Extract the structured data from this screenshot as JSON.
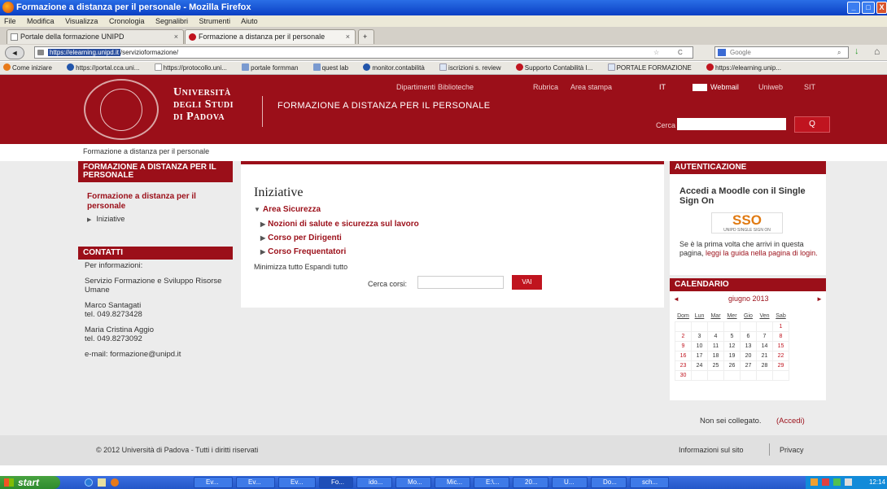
{
  "window": {
    "title": "Formazione a distanza per il personale - Mozilla Firefox",
    "min": "_",
    "max": "□",
    "close": "X"
  },
  "menu": [
    "File",
    "Modifica",
    "Visualizza",
    "Cronologia",
    "Segnalibri",
    "Strumenti",
    "Aiuto"
  ],
  "tabs": [
    {
      "label": "Portale della formazione UNIPD",
      "close": "×"
    },
    {
      "label": "Formazione a distanza per il personale",
      "close": "×"
    },
    {
      "label": "+"
    }
  ],
  "nav": {
    "url_host": "https://elearning.unipd.it",
    "url_path": "/servizioformazione/",
    "search_placeholder": "Google",
    "back": "◄",
    "star": "☆",
    "reload": "C",
    "search_icon": "⌕",
    "download": "↓",
    "home": "⌂"
  },
  "bookmarks": [
    "Come iniziare",
    "https://portal.cca.uni...",
    "https://protocollo.uni...",
    "portale formman",
    "quest lab",
    "monitor.contabilità",
    "iscrizioni s. review",
    "Supporto Contabilità I...",
    "PORTALE FORMAZIONE",
    "https://elearning.unip..."
  ],
  "header": {
    "uni_line1": "Università",
    "uni_line2": "degli Studi",
    "uni_line3": "di Padova",
    "site_title": "FORMAZIONE A DISTANZA PER IL PERSONALE",
    "links": [
      "Dipartimenti",
      "Biblioteche",
      "Rubrica",
      "Area stampa",
      "IT",
      "Webmail",
      "Uniweb",
      "SIT"
    ],
    "search_label": "Cerca",
    "search_button": "Q"
  },
  "breadcrumb": "Formazione a distanza per il personale",
  "left": {
    "course_block_title": "FORMAZIONE A DISTANZA PER IL PERSONALE",
    "course_link": "Formazione a distanza per il personale",
    "course_item": "Iniziative",
    "contacts_title": "CONTATTI",
    "contacts_intro": "Per informazioni:",
    "service": "Servizio Formazione e Sviluppo Risorse Umane",
    "person1": "Marco Santagati",
    "tel1": "tel. 049.8273428",
    "person2": "Maria Cristina Aggio",
    "tel2": "tel. 049.8273092",
    "email": "e-mail: formazione@unipd.it"
  },
  "center": {
    "title": "Iniziative",
    "category": "Area Sicurezza",
    "courses": [
      "Nozioni di salute e sicurezza sul lavoro",
      "Corso per Dirigenti",
      "Corso Frequentatori"
    ],
    "minimize": "Minimizza tutto",
    "expand": "Espandi tutto",
    "search_label": "Cerca corsi:",
    "go_button": "VAI"
  },
  "auth": {
    "title": "AUTENTICAZIONE",
    "heading": "Accedi a Moodle con il Single Sign On",
    "sso_logo": "SSO",
    "sso_caption": "UNIPD SINGLE SIGN ON",
    "note_pre": "Se è la prima volta che arrivi in questa pagina,",
    "note_link": "leggi la guida nella pagina di login."
  },
  "calendar": {
    "title": "CALENDARIO",
    "month": "giugno 2013",
    "prev": "◄",
    "next": "►",
    "weekdays": [
      "Dom",
      "Lun",
      "Mar",
      "Mer",
      "Gio",
      "Ven",
      "Sab"
    ],
    "weeks": [
      [
        "",
        "",
        "",
        "",
        "",
        "",
        "1"
      ],
      [
        "2",
        "3",
        "4",
        "5",
        "6",
        "7",
        "8"
      ],
      [
        "9",
        "10",
        "11",
        "12",
        "13",
        "14",
        "15"
      ],
      [
        "16",
        "17",
        "18",
        "19",
        "20",
        "21",
        "22"
      ],
      [
        "23",
        "24",
        "25",
        "26",
        "27",
        "28",
        "29"
      ],
      [
        "30",
        "",
        "",
        "",
        "",
        "",
        ""
      ]
    ]
  },
  "login_status": {
    "text": "Non sei collegato.",
    "link": "(Accedi)"
  },
  "footer": {
    "copyright": "© 2012 Università di Padova - Tutti i diritti riservati",
    "info": "Informazioni sul sito",
    "privacy": "Privacy"
  },
  "taskbar": {
    "start": "start",
    "buttons": [
      "Ev...",
      "Ev...",
      "Ev...",
      "Fo...",
      "ido...",
      "Mo...",
      "Mic...",
      "E:\\...",
      "20...",
      "U...",
      "Do...",
      "sch..."
    ],
    "clock": "12:14"
  },
  "colors": {
    "brand": "#9b0f19",
    "accent": "#c0141f"
  }
}
